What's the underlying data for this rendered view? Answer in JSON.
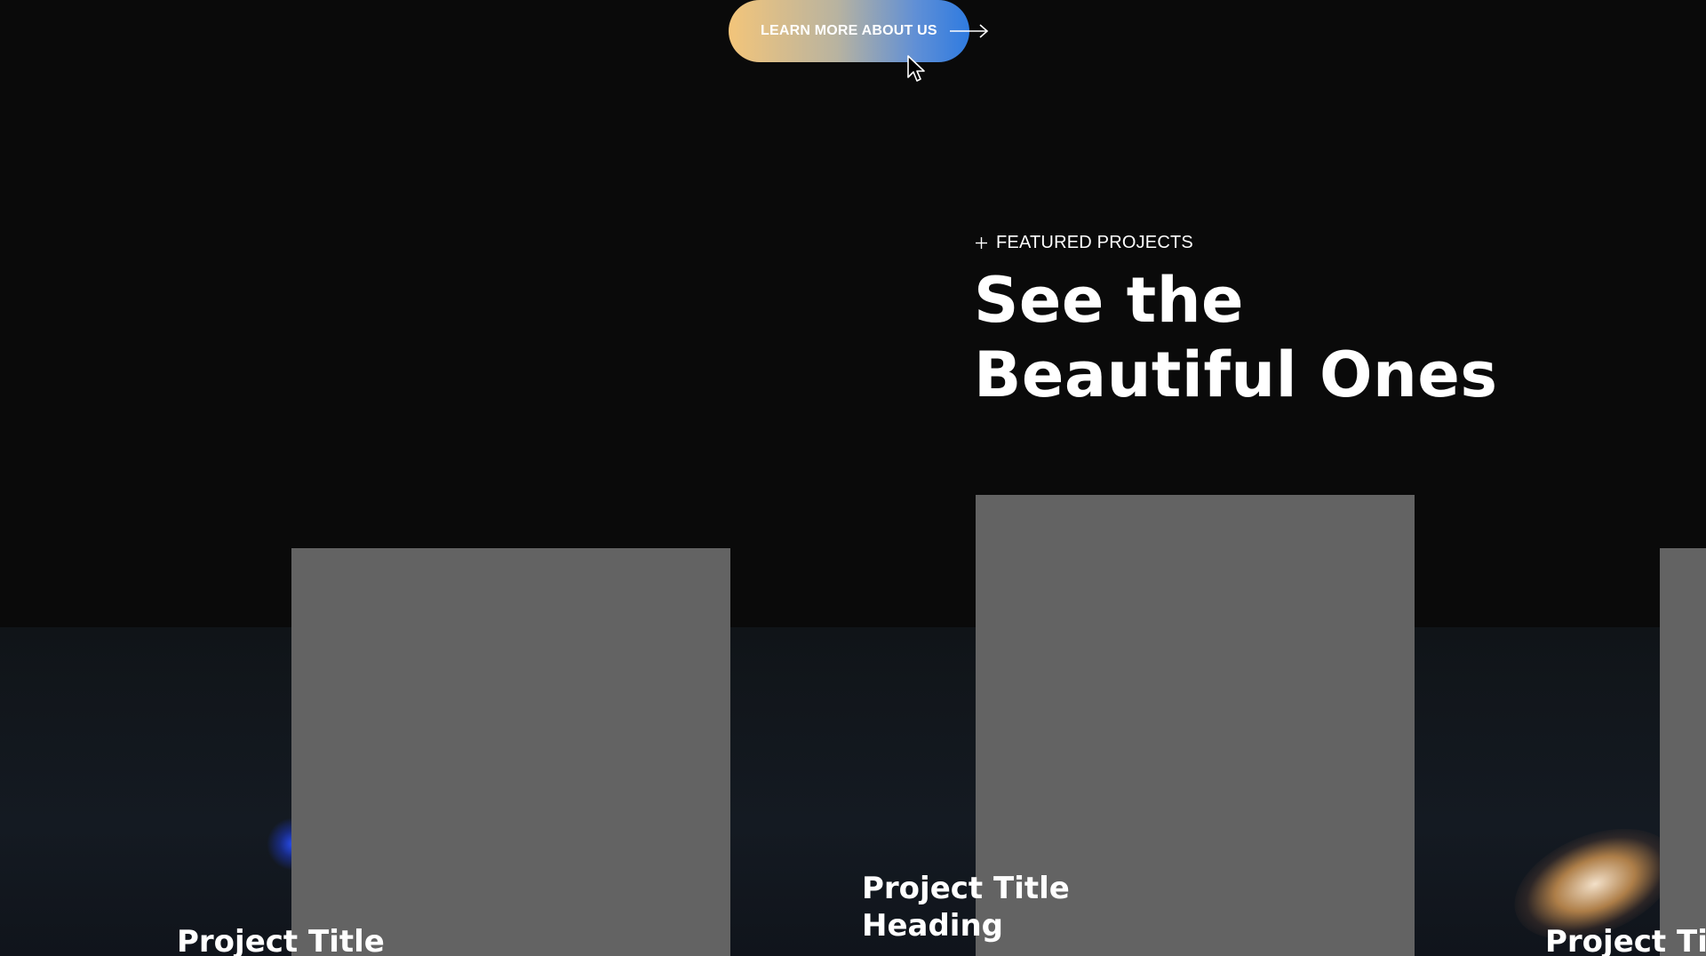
{
  "cta": {
    "label": "LEARN MORE ABOUT US",
    "arrow_icon": "arrow-right-icon"
  },
  "featured": {
    "eyebrow_icon": "plus-icon",
    "eyebrow": "FEATURED PROJECTS",
    "title_line1": "See the",
    "title_line2": "Beautiful Ones"
  },
  "projects": [
    {
      "title_line1": "Project Title",
      "title_line2": ""
    },
    {
      "title_line1": "Project Title",
      "title_line2": "Heading"
    },
    {
      "title_line1": "Project Ti",
      "title_line2": ""
    }
  ],
  "colors": {
    "background": "#0a0a0a",
    "card_placeholder": "#636363",
    "cta_gradient_start": "#f3c57a",
    "cta_gradient_end": "#2f7be0",
    "text": "#ffffff"
  }
}
